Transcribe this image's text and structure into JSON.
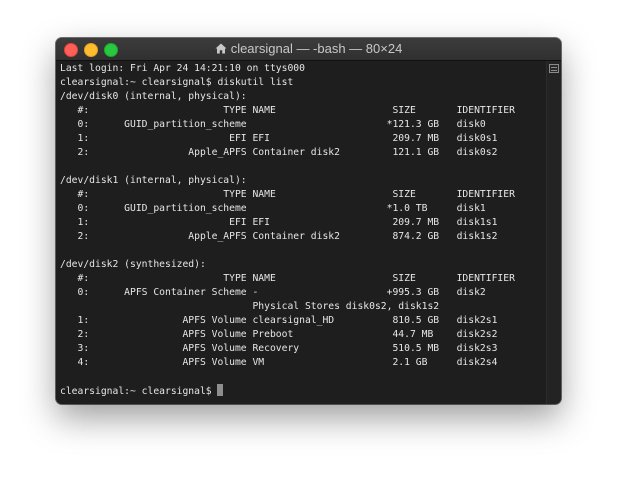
{
  "window": {
    "title": "clearsignal — -bash — 80×24",
    "home_icon": "home-folder-icon",
    "colors": {
      "close": "#fe5f57",
      "minimize": "#febc2e",
      "zoom": "#28c840",
      "background": "#1e1e1e",
      "text": "#e6e6e6"
    }
  },
  "terminal": {
    "lines": [
      "Last login: Fri Apr 24 14:21:10 on ttys000",
      "clearsignal:~ clearsignal$ diskutil list",
      "/dev/disk0 (internal, physical):",
      "   #:                       TYPE NAME                    SIZE       IDENTIFIER",
      "   0:      GUID_partition_scheme                        *121.3 GB   disk0",
      "   1:                        EFI EFI                     209.7 MB   disk0s1",
      "   2:                 Apple_APFS Container disk2         121.1 GB   disk0s2",
      "",
      "/dev/disk1 (internal, physical):",
      "   #:                       TYPE NAME                    SIZE       IDENTIFIER",
      "   0:      GUID_partition_scheme                        *1.0 TB     disk1",
      "   1:                        EFI EFI                     209.7 MB   disk1s1",
      "   2:                 Apple_APFS Container disk2         874.2 GB   disk1s2",
      "",
      "/dev/disk2 (synthesized):",
      "   #:                       TYPE NAME                    SIZE       IDENTIFIER",
      "   0:      APFS Container Scheme -                      +995.3 GB   disk2",
      "                                 Physical Stores disk0s2, disk1s2",
      "   1:                APFS Volume clearsignal_HD          810.5 GB   disk2s1",
      "   2:                APFS Volume Preboot                 44.7 MB    disk2s2",
      "   3:                APFS Volume Recovery                510.5 MB   disk2s3",
      "   4:                APFS Volume VM                      2.1 GB     disk2s4",
      "",
      "clearsignal:~ clearsignal$ "
    ]
  }
}
